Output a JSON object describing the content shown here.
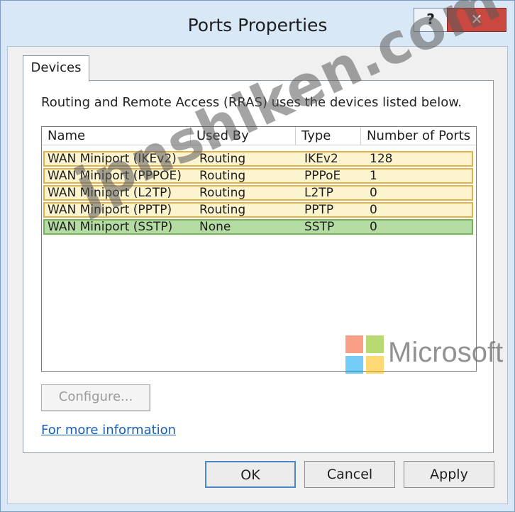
{
  "window": {
    "title": "Ports Properties",
    "help_label": "?",
    "close_label": "✕"
  },
  "tabs": [
    {
      "label": "Devices"
    }
  ],
  "panel": {
    "description": "Routing and Remote Access (RRAS) uses the devices listed below.",
    "columns": [
      "Name",
      "Used By",
      "Type",
      "Number of Ports"
    ],
    "rows": [
      {
        "name": "WAN Miniport (IKEv2)",
        "used_by": "Routing",
        "type": "IKEv2",
        "ports": "128"
      },
      {
        "name": "WAN Miniport (PPPOE)",
        "used_by": "Routing",
        "type": "PPPoE",
        "ports": "1"
      },
      {
        "name": "WAN Miniport (L2TP)",
        "used_by": "Routing",
        "type": "L2TP",
        "ports": "0"
      },
      {
        "name": "WAN Miniport (PPTP)",
        "used_by": "Routing",
        "type": "PPTP",
        "ports": "0"
      },
      {
        "name": "WAN Miniport (SSTP)",
        "used_by": "None",
        "type": "SSTP",
        "ports": "0"
      }
    ],
    "configure_label": "Configure...",
    "more_info_link": "For more information"
  },
  "buttons": {
    "ok": "OK",
    "cancel": "Cancel",
    "apply": "Apply"
  },
  "overlay": {
    "watermark": "jpnshiken.com",
    "brand": "Microsoft"
  },
  "colors": {
    "selected_row_border": "#e2b24a",
    "focused_row_fill": "#b5dca3",
    "close_button": "#c9483f",
    "link": "#1a5fb4"
  }
}
